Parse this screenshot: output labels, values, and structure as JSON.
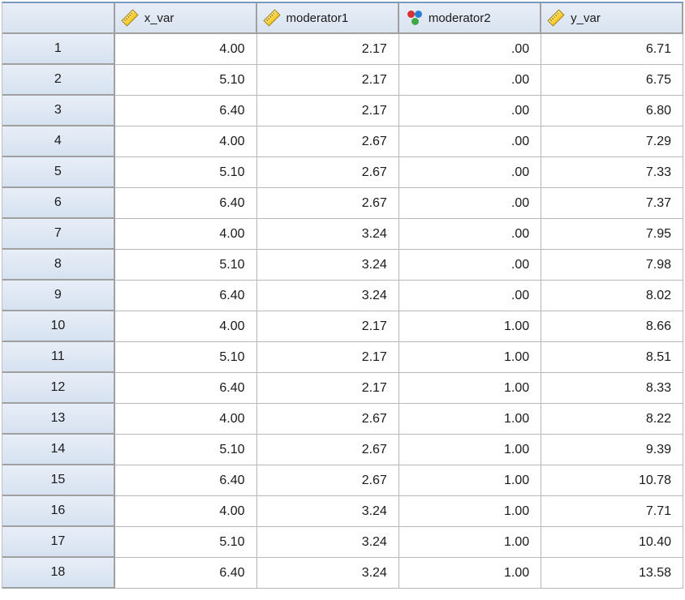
{
  "columns": [
    {
      "name": "x_var",
      "icon": "ruler"
    },
    {
      "name": "moderator1",
      "icon": "ruler"
    },
    {
      "name": "moderator2",
      "icon": "nominal"
    },
    {
      "name": "y_var",
      "icon": "ruler"
    }
  ],
  "rows": [
    {
      "n": "1",
      "x_var": "4.00",
      "moderator1": "2.17",
      "moderator2": ".00",
      "y_var": "6.71"
    },
    {
      "n": "2",
      "x_var": "5.10",
      "moderator1": "2.17",
      "moderator2": ".00",
      "y_var": "6.75"
    },
    {
      "n": "3",
      "x_var": "6.40",
      "moderator1": "2.17",
      "moderator2": ".00",
      "y_var": "6.80"
    },
    {
      "n": "4",
      "x_var": "4.00",
      "moderator1": "2.67",
      "moderator2": ".00",
      "y_var": "7.29"
    },
    {
      "n": "5",
      "x_var": "5.10",
      "moderator1": "2.67",
      "moderator2": ".00",
      "y_var": "7.33"
    },
    {
      "n": "6",
      "x_var": "6.40",
      "moderator1": "2.67",
      "moderator2": ".00",
      "y_var": "7.37"
    },
    {
      "n": "7",
      "x_var": "4.00",
      "moderator1": "3.24",
      "moderator2": ".00",
      "y_var": "7.95"
    },
    {
      "n": "8",
      "x_var": "5.10",
      "moderator1": "3.24",
      "moderator2": ".00",
      "y_var": "7.98"
    },
    {
      "n": "9",
      "x_var": "6.40",
      "moderator1": "3.24",
      "moderator2": ".00",
      "y_var": "8.02"
    },
    {
      "n": "10",
      "x_var": "4.00",
      "moderator1": "2.17",
      "moderator2": "1.00",
      "y_var": "8.66"
    },
    {
      "n": "11",
      "x_var": "5.10",
      "moderator1": "2.17",
      "moderator2": "1.00",
      "y_var": "8.51"
    },
    {
      "n": "12",
      "x_var": "6.40",
      "moderator1": "2.17",
      "moderator2": "1.00",
      "y_var": "8.33"
    },
    {
      "n": "13",
      "x_var": "4.00",
      "moderator1": "2.67",
      "moderator2": "1.00",
      "y_var": "8.22"
    },
    {
      "n": "14",
      "x_var": "5.10",
      "moderator1": "2.67",
      "moderator2": "1.00",
      "y_var": "9.39"
    },
    {
      "n": "15",
      "x_var": "6.40",
      "moderator1": "2.67",
      "moderator2": "1.00",
      "y_var": "10.78"
    },
    {
      "n": "16",
      "x_var": "4.00",
      "moderator1": "3.24",
      "moderator2": "1.00",
      "y_var": "7.71"
    },
    {
      "n": "17",
      "x_var": "5.10",
      "moderator1": "3.24",
      "moderator2": "1.00",
      "y_var": "10.40"
    },
    {
      "n": "18",
      "x_var": "6.40",
      "moderator1": "3.24",
      "moderator2": "1.00",
      "y_var": "13.58"
    }
  ]
}
